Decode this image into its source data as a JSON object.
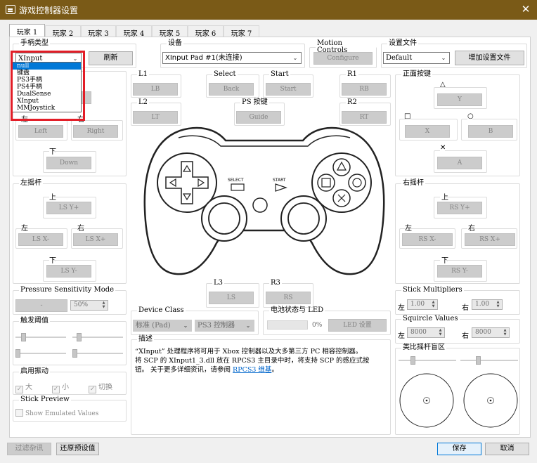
{
  "window": {
    "title": "游戏控制器设置",
    "close": "✕"
  },
  "tabs": [
    "玩家 1",
    "玩家 2",
    "玩家 3",
    "玩家 4",
    "玩家 5",
    "玩家 6",
    "玩家 7"
  ],
  "handler": {
    "label": "手柄类型",
    "value": "XInput",
    "refresh": "刷新",
    "options": [
      "键盘",
      "PS3手柄",
      "PS4手柄",
      "DualSense",
      "XInput",
      "MMJoystick"
    ],
    "highlighted_option": "null"
  },
  "device": {
    "label": "设备",
    "value": "XInput Pad #1(未连接)"
  },
  "motion": {
    "label": "Motion Controls",
    "button": "Configure"
  },
  "config": {
    "label": "设置文件",
    "value": "Default",
    "add": "增加设置文件"
  },
  "dpad": {
    "up": "上",
    "left": "左",
    "right": "右",
    "down": "下",
    "left_btn": "Left",
    "right_btn": "Right",
    "down_btn": "Down"
  },
  "shoulders": {
    "l1": "L1",
    "lb": "LB",
    "l2": "L2",
    "lt": "LT",
    "select": "Select",
    "back": "Back",
    "start": "Start",
    "start_btn": "Start",
    "r1": "R1",
    "rb": "RB",
    "r2": "R2",
    "rt": "RT",
    "ps": "PS 按键",
    "guide": "Guide"
  },
  "face": {
    "label": "正面按键",
    "triangle": "△",
    "y": "Y",
    "square": "□",
    "x": "X",
    "circle": "○",
    "b": "B",
    "cross": "✕",
    "a": "A"
  },
  "lstick": {
    "label": "左摇杆",
    "up": "上",
    "up_btn": "LS Y+",
    "left": "左",
    "left_btn": "LS X-",
    "right": "右",
    "right_btn": "LS X+",
    "down": "下",
    "down_btn": "LS Y-"
  },
  "rstick": {
    "label": "右摇杆",
    "up": "上",
    "up_btn": "RS Y+",
    "left": "左",
    "left_btn": "RS X-",
    "right": "右",
    "right_btn": "RS X+",
    "down": "下",
    "down_btn": "RS Y-"
  },
  "l3": {
    "label": "L3",
    "btn": "LS"
  },
  "r3": {
    "label": "R3",
    "btn": "RS"
  },
  "controller_img": {
    "select": "SELECT",
    "start": "START"
  },
  "pressure": {
    "label": "Pressure Sensitivity Mode",
    "btn": "-",
    "value": "50%"
  },
  "trigger": {
    "label": "触发阈值"
  },
  "vibration": {
    "label": "启用振动",
    "large": "大",
    "small": "小",
    "switch": "切换"
  },
  "preview": {
    "label": "Stick Preview",
    "show": "Show Emulated Values"
  },
  "device_class": {
    "label": "Device Class",
    "class_value": "标准 (Pad)",
    "type_value": "PS3 控制器"
  },
  "battery": {
    "label": "电池状态与 LED",
    "percent": "0%",
    "led": "LED 设置"
  },
  "description": {
    "label": "描述",
    "line1": "“XInput” 处理程序将可用于 Xbox 控制器以及大多第三方 PC 相容控制器。",
    "line2": "将 SCP 的 XInput1_3.dll 放在 RPCS3 主目录中时，将支持 SCP 的感应式按",
    "line3_a": "钮。 关于更多详细资讯，请参阅 ",
    "line3_link": "RPCS3 维基",
    "line3_b": "。"
  },
  "stick_mult": {
    "label": "Stick Multipliers",
    "left": "左",
    "left_val": "1.00",
    "right": "右",
    "right_val": "1.00"
  },
  "squircle": {
    "label": "Squircle Values",
    "left": "左",
    "left_val": "8000",
    "right": "右",
    "right_val": "8000"
  },
  "deadzone": {
    "label": "类比摇杆盲区"
  },
  "footer": {
    "filter": "过滤杂讯",
    "restore": "还原预设值",
    "save": "保存",
    "cancel": "取消"
  }
}
